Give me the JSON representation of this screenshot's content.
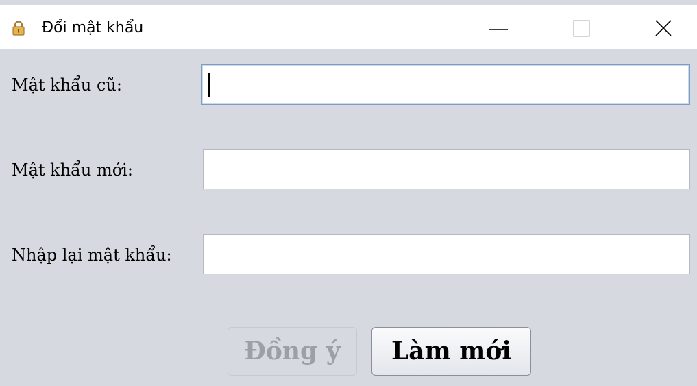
{
  "window": {
    "title": "Đổi mật khẩu",
    "icon": "lock-icon",
    "controls": {
      "minimize": "minimize-icon",
      "maximize": "maximize-icon",
      "close": "close-icon"
    }
  },
  "form": {
    "old_password": {
      "label": "Mật khẩu cũ:",
      "value": ""
    },
    "new_password": {
      "label": "Mật khẩu mới:",
      "value": ""
    },
    "confirm_password": {
      "label": "Nhập lại mật khẩu:",
      "value": ""
    }
  },
  "buttons": {
    "confirm": "Đồng ý",
    "reset": "Làm mới"
  },
  "colors": {
    "background": "#d6d9e0",
    "focus_border": "#7a9cc6",
    "disabled_text": "#9c9fa6"
  }
}
